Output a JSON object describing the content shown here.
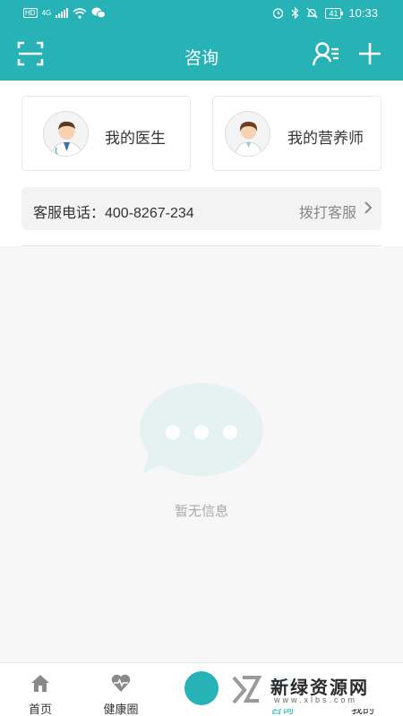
{
  "status_bar": {
    "network": "4G",
    "hd": "HD",
    "battery": "41",
    "time": "10:33"
  },
  "header": {
    "title": "咨询",
    "icons": [
      "scan-icon",
      "doctor-list-icon",
      "add-icon"
    ]
  },
  "cards": [
    {
      "label": "我的医生",
      "avatar": "doctor-avatar-icon"
    },
    {
      "label": "我的营养师",
      "avatar": "nutritionist-avatar-icon"
    }
  ],
  "service": {
    "label": "客服电话：400-8267-234",
    "action": "拨打客服"
  },
  "empty_state": {
    "icon": "chat-bubble-icon",
    "text": "暂无信息"
  },
  "tabbar": {
    "items": [
      {
        "label": "首页",
        "icon": "home-icon"
      },
      {
        "label": "健康圈",
        "icon": "heart-pulse-icon"
      },
      {
        "label": "",
        "icon": "plus-circle-icon"
      },
      {
        "label": "咨询",
        "icon": "chat-icon"
      },
      {
        "label": "我的",
        "icon": "user-icon"
      }
    ],
    "active": "咨询"
  },
  "watermark": {
    "cn": "新绿资源网",
    "en": "www.xlbs.com"
  },
  "colors": {
    "primary": "#27b2b6",
    "background": "#f7f7f7"
  }
}
